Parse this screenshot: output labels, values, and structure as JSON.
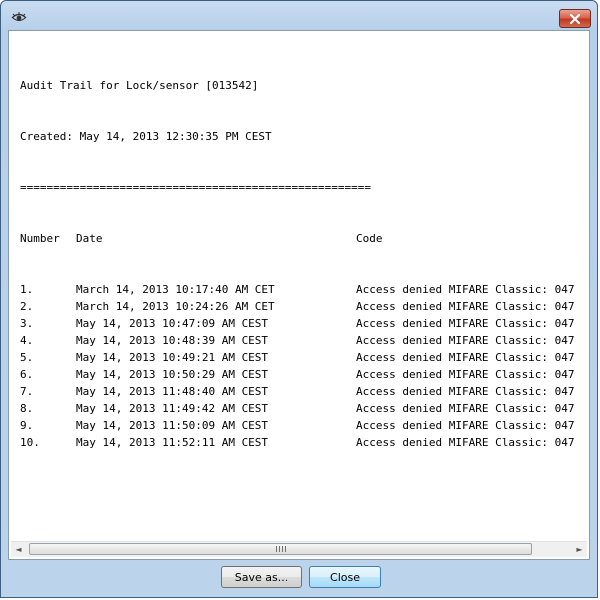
{
  "report": {
    "title_line": "Audit Trail for Lock/sensor [013542]",
    "created_line": "Created: May 14, 2013 12:30:35 PM CEST",
    "separator": "=====================================================",
    "headers": {
      "number": "Number",
      "date": "Date",
      "code": "Code"
    },
    "rows": [
      {
        "number": "1.",
        "date": "March 14, 2013 10:17:40 AM CET",
        "code": "Access denied  MIFARE Classic: 047"
      },
      {
        "number": "2.",
        "date": "March 14, 2013 10:24:26 AM CET",
        "code": "Access denied  MIFARE Classic: 047"
      },
      {
        "number": "3.",
        "date": "May 14, 2013 10:47:09 AM CEST",
        "code": "Access denied  MIFARE Classic: 047"
      },
      {
        "number": "4.",
        "date": "May 14, 2013 10:48:39 AM CEST",
        "code": "Access denied  MIFARE Classic: 047"
      },
      {
        "number": "5.",
        "date": "May 14, 2013 10:49:21 AM CEST",
        "code": "Access denied  MIFARE Classic: 047"
      },
      {
        "number": "6.",
        "date": "May 14, 2013 10:50:29 AM CEST",
        "code": "Access denied  MIFARE Classic: 047"
      },
      {
        "number": "7.",
        "date": "May 14, 2013 11:48:40 AM CEST",
        "code": "Access denied  MIFARE Classic: 047"
      },
      {
        "number": "8.",
        "date": "May 14, 2013 11:49:42 AM CEST",
        "code": "Access denied  MIFARE Classic: 047"
      },
      {
        "number": "9.",
        "date": "May 14, 2013 11:50:09 AM CEST",
        "code": "Access denied  MIFARE Classic: 047"
      },
      {
        "number": "10.",
        "date": "May 14, 2013 11:52:11 AM CEST",
        "code": "Access denied  MIFARE Classic: 047"
      }
    ]
  },
  "scrollbar": {
    "left_arrow": "◄",
    "right_arrow": "►"
  },
  "buttons": {
    "save_as": "Save as...",
    "close": "Close"
  },
  "icons": {
    "app": "eye-icon",
    "close": "close-icon"
  }
}
